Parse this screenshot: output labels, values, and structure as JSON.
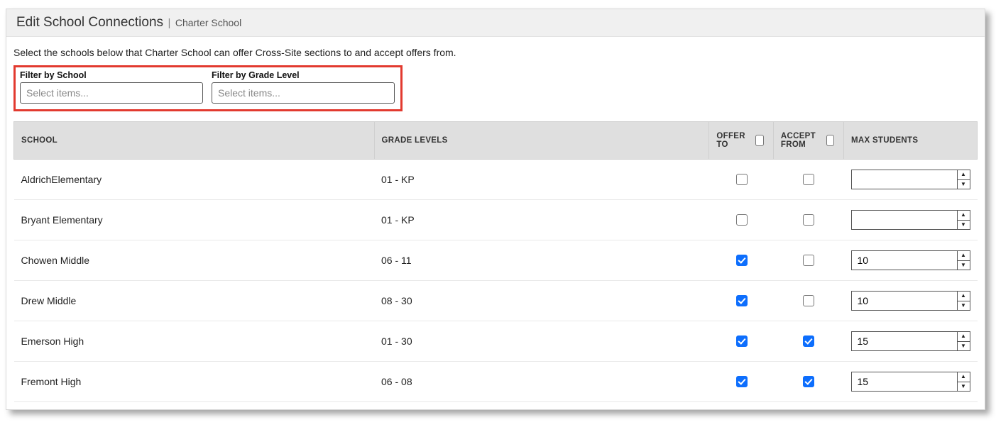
{
  "header": {
    "title": "Edit School Connections",
    "subtitle": "Charter School"
  },
  "instruction": "Select the schools below that Charter School can offer Cross-Site sections to and accept offers from.",
  "filters": {
    "school": {
      "label": "Filter by School",
      "placeholder": "Select items..."
    },
    "grade": {
      "label": "Filter by Grade Level",
      "placeholder": "Select items..."
    }
  },
  "columns": {
    "school": "SCHOOL",
    "grade": "GRADE LEVELS",
    "offer": "OFFER TO",
    "accept": "ACCEPT FROM",
    "max": "MAX STUDENTS"
  },
  "rows": [
    {
      "school": "AldrichElementary",
      "grade": "01 - KP",
      "offer": false,
      "accept": false,
      "max": ""
    },
    {
      "school": "Bryant Elementary",
      "grade": "01 - KP",
      "offer": false,
      "accept": false,
      "max": ""
    },
    {
      "school": "Chowen Middle",
      "grade": "06 - 11",
      "offer": true,
      "accept": false,
      "max": "10"
    },
    {
      "school": "Drew Middle",
      "grade": "08 - 30",
      "offer": true,
      "accept": false,
      "max": "10"
    },
    {
      "school": "Emerson High",
      "grade": "01 - 30",
      "offer": true,
      "accept": true,
      "max": "15"
    },
    {
      "school": "Fremont High",
      "grade": "06 - 08",
      "offer": true,
      "accept": true,
      "max": "15"
    }
  ]
}
